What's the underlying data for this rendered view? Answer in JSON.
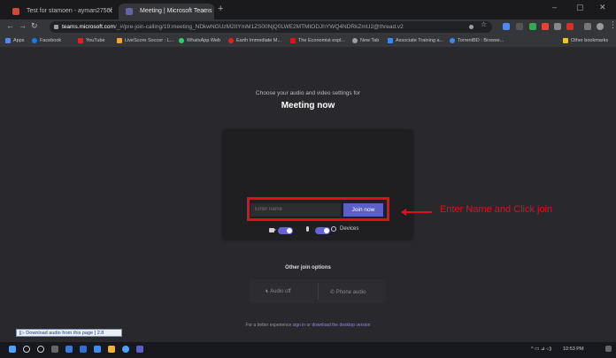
{
  "browser": {
    "tabs": [
      {
        "title": "Test for stamoen - ayman2750f"
      },
      {
        "title": "Meeting | Microsoft Teams",
        "active": true
      }
    ],
    "new_tab_symbol": "+",
    "window_controls": [
      "–",
      "▢",
      "✕"
    ],
    "url_host": "teams.microsoft.com",
    "url_path": "/_#/pre-join-calling/19:meeting_NDkwNGUzM2ItYmM1ZS00NjQ0LWE2MTMtODJhYWQ4NDRkZmU2@thread.v2",
    "bookmarks": [
      {
        "label": "Apps",
        "color": "#4a8af4"
      },
      {
        "label": "Facebook",
        "color": "#1877f2"
      },
      {
        "label": "YouTube",
        "color": "#e62117"
      },
      {
        "label": "LiveScore Soccer : L...",
        "color": "#f5a623"
      },
      {
        "label": "WhatsApp Web",
        "color": "#25d366"
      },
      {
        "label": "Earth Immediate M...",
        "color": "#e62117"
      },
      {
        "label": "The Economist expl...",
        "color": "#e3120b"
      },
      {
        "label": "New Tab",
        "color": "#9aa0a6"
      },
      {
        "label": "Associate Training a...",
        "color": "#2d8cff"
      },
      {
        "label": "TorrentBD : Browse...",
        "color": "#3b8beb"
      }
    ],
    "other_bookmarks": "Other bookmarks"
  },
  "prejoin": {
    "subtitle": "Choose your audio and video settings for",
    "title": "Meeting now",
    "name_placeholder": "Enter name",
    "join_label": "Join now",
    "devices_label": "Devices",
    "other_join_options": "Other join options",
    "audio_off_label": "Audio off",
    "phone_audio_label": "Phone audio",
    "footer_prefix": "For a better experience",
    "footer_link1": "sign in",
    "footer_mid": "or",
    "footer_link2": "download the desktop version"
  },
  "annotation": {
    "text": "Enter Name and Click join",
    "color": "#e0101b"
  },
  "download_bar": "[▷ Download audio from this page ] 2.8",
  "taskbar": {
    "clock": "10:53 PM"
  },
  "colors": {
    "accent": "#5b5fc7",
    "page_bg": "#28282d"
  }
}
